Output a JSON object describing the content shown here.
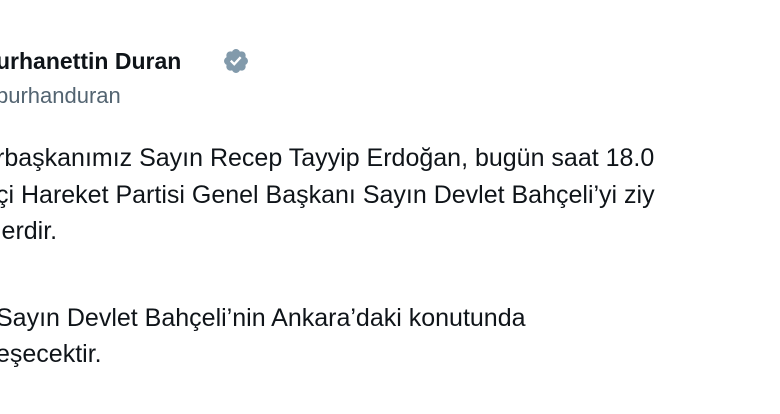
{
  "tweet": {
    "author": {
      "name": "urhanettin Duran",
      "handle": "burhanduran",
      "verified_color": "#829aab"
    },
    "paragraphs": [
      {
        "lines": [
          "rbaşkanımız Sayın Recep Tayyip Erdoğan, bugün saat 18.0",
          "çi Hareket Partisi Genel Başkanı Sayın Devlet Bahçeli’yi ziy",
          "lerdir."
        ]
      },
      {
        "lines": [
          " Sayın Devlet Bahçeli’nin Ankara’daki konutunda",
          "eşecektir."
        ]
      }
    ]
  }
}
